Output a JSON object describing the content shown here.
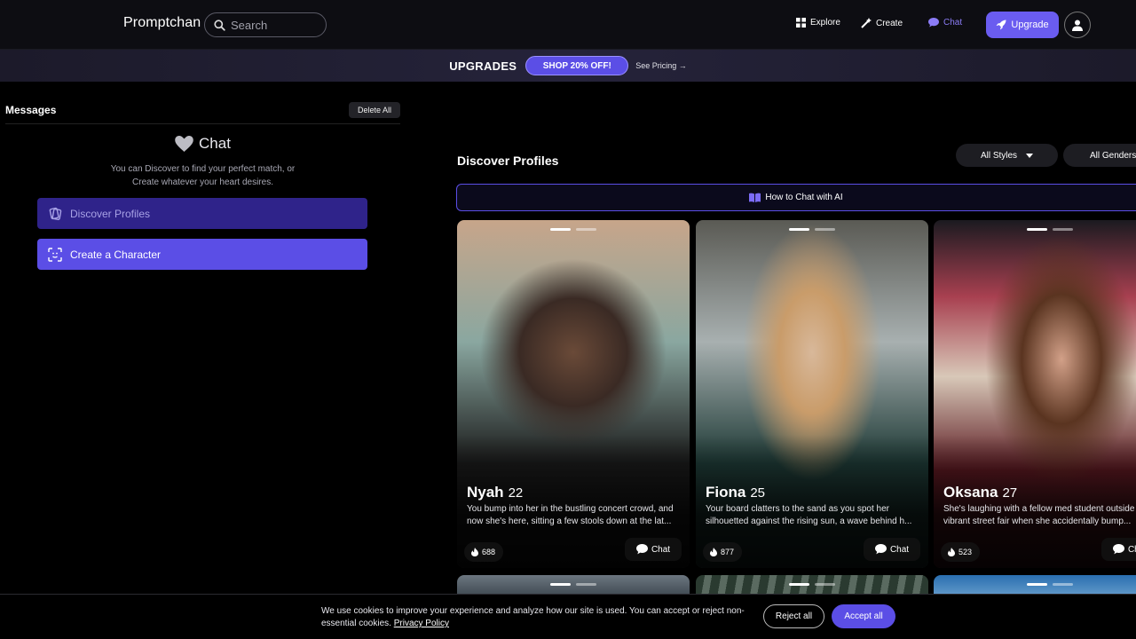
{
  "nav": {
    "logo": "Promptchan",
    "search_placeholder": "Search",
    "explore": "Explore",
    "create": "Create",
    "chat": "Chat",
    "upgrade": "Upgrade"
  },
  "promo": {
    "title": "UPGRADES",
    "button": "SHOP 20% OFF!",
    "link": "See Pricing →"
  },
  "messages": {
    "header": "Messages",
    "delete_all": "Delete All",
    "chat_heading": "Chat",
    "subtitle_line1": "You can Discover to find your perfect match, or",
    "subtitle_line2": "Create whatever your heart desires.",
    "discover_button": "Discover Profiles",
    "create_button": "Create a Character"
  },
  "discover": {
    "title": "Discover Profiles",
    "filter_styles": "All Styles",
    "filter_genders": "All Genders",
    "how_to": "How to Chat with AI",
    "chat_label": "Chat",
    "profiles": [
      {
        "name": "Nyah",
        "age": "22",
        "desc": "You bump into her in the bustling concert crowd, and now she's here, sitting a few stools down at the lat...",
        "likes": "688"
      },
      {
        "name": "Fiona",
        "age": "25",
        "desc": "Your board clatters to the sand as you spot her silhouetted against the rising sun, a wave behind h...",
        "likes": "877"
      },
      {
        "name": "Oksana",
        "age": "27",
        "desc": "She's laughing with a fellow med student outside a vibrant street fair when she accidentally bump...",
        "likes": "523"
      }
    ]
  },
  "cookie": {
    "text": "We use cookies to improve your experience and analyze how our site is used. You can accept or reject non-essential cookies.",
    "policy_link": "Privacy Policy",
    "reject": "Reject all",
    "accept": "Accept all"
  },
  "colors": {
    "accent": "#5b4ee6",
    "background": "#000000",
    "nav_bg": "#0d0d12"
  }
}
